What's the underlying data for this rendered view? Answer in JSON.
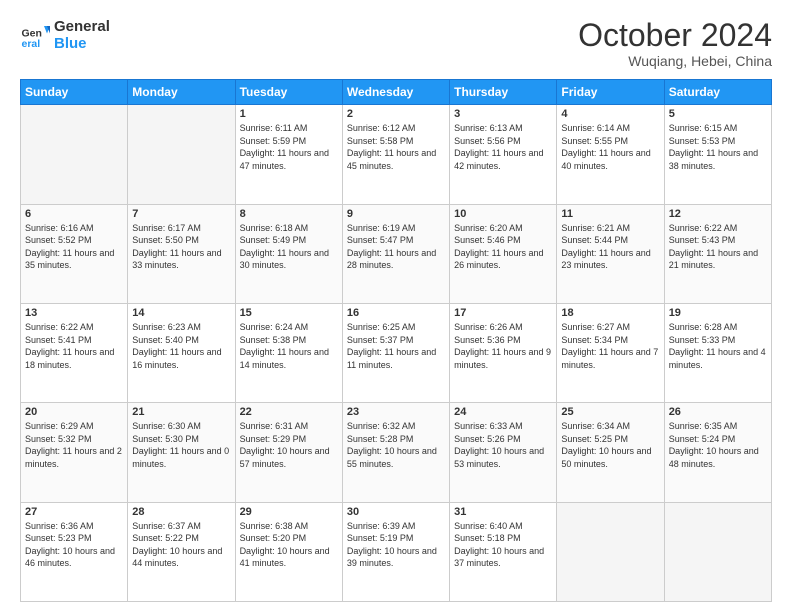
{
  "header": {
    "logo_general": "General",
    "logo_blue": "Blue",
    "month": "October 2024",
    "location": "Wuqiang, Hebei, China"
  },
  "weekdays": [
    "Sunday",
    "Monday",
    "Tuesday",
    "Wednesday",
    "Thursday",
    "Friday",
    "Saturday"
  ],
  "weeks": [
    [
      {
        "day": "",
        "sunrise": "",
        "sunset": "",
        "daylight": ""
      },
      {
        "day": "",
        "sunrise": "",
        "sunset": "",
        "daylight": ""
      },
      {
        "day": "1",
        "sunrise": "Sunrise: 6:11 AM",
        "sunset": "Sunset: 5:59 PM",
        "daylight": "Daylight: 11 hours and 47 minutes."
      },
      {
        "day": "2",
        "sunrise": "Sunrise: 6:12 AM",
        "sunset": "Sunset: 5:58 PM",
        "daylight": "Daylight: 11 hours and 45 minutes."
      },
      {
        "day": "3",
        "sunrise": "Sunrise: 6:13 AM",
        "sunset": "Sunset: 5:56 PM",
        "daylight": "Daylight: 11 hours and 42 minutes."
      },
      {
        "day": "4",
        "sunrise": "Sunrise: 6:14 AM",
        "sunset": "Sunset: 5:55 PM",
        "daylight": "Daylight: 11 hours and 40 minutes."
      },
      {
        "day": "5",
        "sunrise": "Sunrise: 6:15 AM",
        "sunset": "Sunset: 5:53 PM",
        "daylight": "Daylight: 11 hours and 38 minutes."
      }
    ],
    [
      {
        "day": "6",
        "sunrise": "Sunrise: 6:16 AM",
        "sunset": "Sunset: 5:52 PM",
        "daylight": "Daylight: 11 hours and 35 minutes."
      },
      {
        "day": "7",
        "sunrise": "Sunrise: 6:17 AM",
        "sunset": "Sunset: 5:50 PM",
        "daylight": "Daylight: 11 hours and 33 minutes."
      },
      {
        "day": "8",
        "sunrise": "Sunrise: 6:18 AM",
        "sunset": "Sunset: 5:49 PM",
        "daylight": "Daylight: 11 hours and 30 minutes."
      },
      {
        "day": "9",
        "sunrise": "Sunrise: 6:19 AM",
        "sunset": "Sunset: 5:47 PM",
        "daylight": "Daylight: 11 hours and 28 minutes."
      },
      {
        "day": "10",
        "sunrise": "Sunrise: 6:20 AM",
        "sunset": "Sunset: 5:46 PM",
        "daylight": "Daylight: 11 hours and 26 minutes."
      },
      {
        "day": "11",
        "sunrise": "Sunrise: 6:21 AM",
        "sunset": "Sunset: 5:44 PM",
        "daylight": "Daylight: 11 hours and 23 minutes."
      },
      {
        "day": "12",
        "sunrise": "Sunrise: 6:22 AM",
        "sunset": "Sunset: 5:43 PM",
        "daylight": "Daylight: 11 hours and 21 minutes."
      }
    ],
    [
      {
        "day": "13",
        "sunrise": "Sunrise: 6:22 AM",
        "sunset": "Sunset: 5:41 PM",
        "daylight": "Daylight: 11 hours and 18 minutes."
      },
      {
        "day": "14",
        "sunrise": "Sunrise: 6:23 AM",
        "sunset": "Sunset: 5:40 PM",
        "daylight": "Daylight: 11 hours and 16 minutes."
      },
      {
        "day": "15",
        "sunrise": "Sunrise: 6:24 AM",
        "sunset": "Sunset: 5:38 PM",
        "daylight": "Daylight: 11 hours and 14 minutes."
      },
      {
        "day": "16",
        "sunrise": "Sunrise: 6:25 AM",
        "sunset": "Sunset: 5:37 PM",
        "daylight": "Daylight: 11 hours and 11 minutes."
      },
      {
        "day": "17",
        "sunrise": "Sunrise: 6:26 AM",
        "sunset": "Sunset: 5:36 PM",
        "daylight": "Daylight: 11 hours and 9 minutes."
      },
      {
        "day": "18",
        "sunrise": "Sunrise: 6:27 AM",
        "sunset": "Sunset: 5:34 PM",
        "daylight": "Daylight: 11 hours and 7 minutes."
      },
      {
        "day": "19",
        "sunrise": "Sunrise: 6:28 AM",
        "sunset": "Sunset: 5:33 PM",
        "daylight": "Daylight: 11 hours and 4 minutes."
      }
    ],
    [
      {
        "day": "20",
        "sunrise": "Sunrise: 6:29 AM",
        "sunset": "Sunset: 5:32 PM",
        "daylight": "Daylight: 11 hours and 2 minutes."
      },
      {
        "day": "21",
        "sunrise": "Sunrise: 6:30 AM",
        "sunset": "Sunset: 5:30 PM",
        "daylight": "Daylight: 11 hours and 0 minutes."
      },
      {
        "day": "22",
        "sunrise": "Sunrise: 6:31 AM",
        "sunset": "Sunset: 5:29 PM",
        "daylight": "Daylight: 10 hours and 57 minutes."
      },
      {
        "day": "23",
        "sunrise": "Sunrise: 6:32 AM",
        "sunset": "Sunset: 5:28 PM",
        "daylight": "Daylight: 10 hours and 55 minutes."
      },
      {
        "day": "24",
        "sunrise": "Sunrise: 6:33 AM",
        "sunset": "Sunset: 5:26 PM",
        "daylight": "Daylight: 10 hours and 53 minutes."
      },
      {
        "day": "25",
        "sunrise": "Sunrise: 6:34 AM",
        "sunset": "Sunset: 5:25 PM",
        "daylight": "Daylight: 10 hours and 50 minutes."
      },
      {
        "day": "26",
        "sunrise": "Sunrise: 6:35 AM",
        "sunset": "Sunset: 5:24 PM",
        "daylight": "Daylight: 10 hours and 48 minutes."
      }
    ],
    [
      {
        "day": "27",
        "sunrise": "Sunrise: 6:36 AM",
        "sunset": "Sunset: 5:23 PM",
        "daylight": "Daylight: 10 hours and 46 minutes."
      },
      {
        "day": "28",
        "sunrise": "Sunrise: 6:37 AM",
        "sunset": "Sunset: 5:22 PM",
        "daylight": "Daylight: 10 hours and 44 minutes."
      },
      {
        "day": "29",
        "sunrise": "Sunrise: 6:38 AM",
        "sunset": "Sunset: 5:20 PM",
        "daylight": "Daylight: 10 hours and 41 minutes."
      },
      {
        "day": "30",
        "sunrise": "Sunrise: 6:39 AM",
        "sunset": "Sunset: 5:19 PM",
        "daylight": "Daylight: 10 hours and 39 minutes."
      },
      {
        "day": "31",
        "sunrise": "Sunrise: 6:40 AM",
        "sunset": "Sunset: 5:18 PM",
        "daylight": "Daylight: 10 hours and 37 minutes."
      },
      {
        "day": "",
        "sunrise": "",
        "sunset": "",
        "daylight": ""
      },
      {
        "day": "",
        "sunrise": "",
        "sunset": "",
        "daylight": ""
      }
    ]
  ]
}
